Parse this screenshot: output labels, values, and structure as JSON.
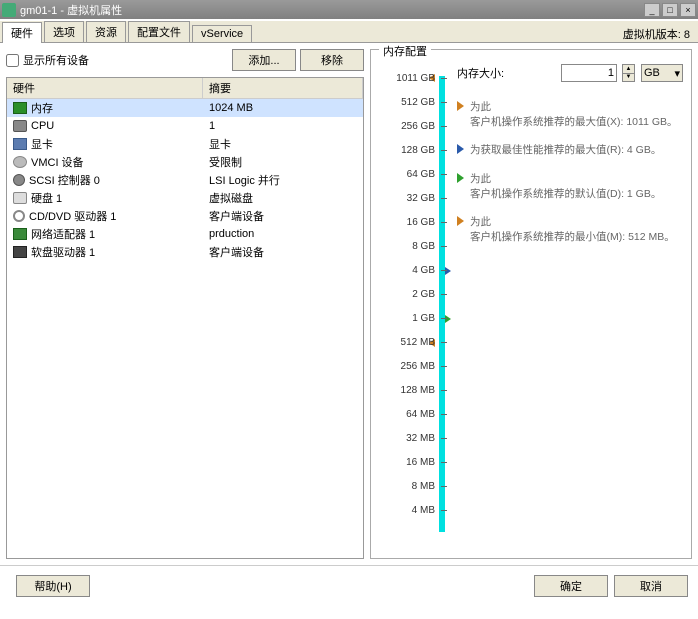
{
  "titlebar": {
    "title": "gm01-1 - 虚拟机属性"
  },
  "tabs": [
    "硬件",
    "选项",
    "资源",
    "配置文件",
    "vService"
  ],
  "vm_version": "虚拟机版本: 8",
  "show_all_devices_label": "显示所有设备",
  "add_btn": "添加...",
  "remove_btn": "移除",
  "hw_headers": {
    "hardware": "硬件",
    "summary": "摘要"
  },
  "hw": [
    {
      "icon": "mem",
      "name": "内存",
      "summary": "1024 MB",
      "selected": true
    },
    {
      "icon": "cpu",
      "name": "CPU",
      "summary": "1"
    },
    {
      "icon": "video",
      "name": "显卡",
      "summary": "显卡"
    },
    {
      "icon": "vmci",
      "name": "VMCI 设备",
      "summary": "受限制"
    },
    {
      "icon": "scsi",
      "name": "SCSI 控制器 0",
      "summary": "LSI Logic 并行"
    },
    {
      "icon": "disk",
      "name": "硬盘 1",
      "summary": "虚拟磁盘"
    },
    {
      "icon": "cd",
      "name": "CD/DVD 驱动器 1",
      "summary": "客户端设备"
    },
    {
      "icon": "nic",
      "name": "网络适配器 1",
      "summary": "prduction"
    },
    {
      "icon": "floppy",
      "name": "软盘驱动器 1",
      "summary": "客户端设备"
    }
  ],
  "mem_panel": {
    "legend": "内存配置",
    "size_label": "内存大小:",
    "size_value": "1",
    "unit": "GB",
    "scale": [
      "1011 GB",
      "512 GB",
      "256 GB",
      "128 GB",
      "64 GB",
      "32 GB",
      "16 GB",
      "8 GB",
      "4 GB",
      "2 GB",
      "1 GB",
      "512 MB",
      "256 MB",
      "128 MB",
      "64 MB",
      "32 MB",
      "16 MB",
      "8 MB",
      "4 MB"
    ],
    "notes": [
      {
        "color": "orange",
        "line1": "为此",
        "line2": "客户机操作系统推荐的最大值(X): 1011 GB。"
      },
      {
        "color": "blue",
        "line1": "",
        "line2": "为获取最佳性能推荐的最大值(R): 4 GB。"
      },
      {
        "color": "green",
        "line1": "为此",
        "line2": "客户机操作系统推荐的默认值(D): 1 GB。"
      },
      {
        "color": "orange",
        "line1": "为此",
        "line2": "客户机操作系统推荐的最小值(M): 512 MB。"
      }
    ]
  },
  "footer": {
    "help": "帮助(H)",
    "ok": "确定",
    "cancel": "取消"
  }
}
